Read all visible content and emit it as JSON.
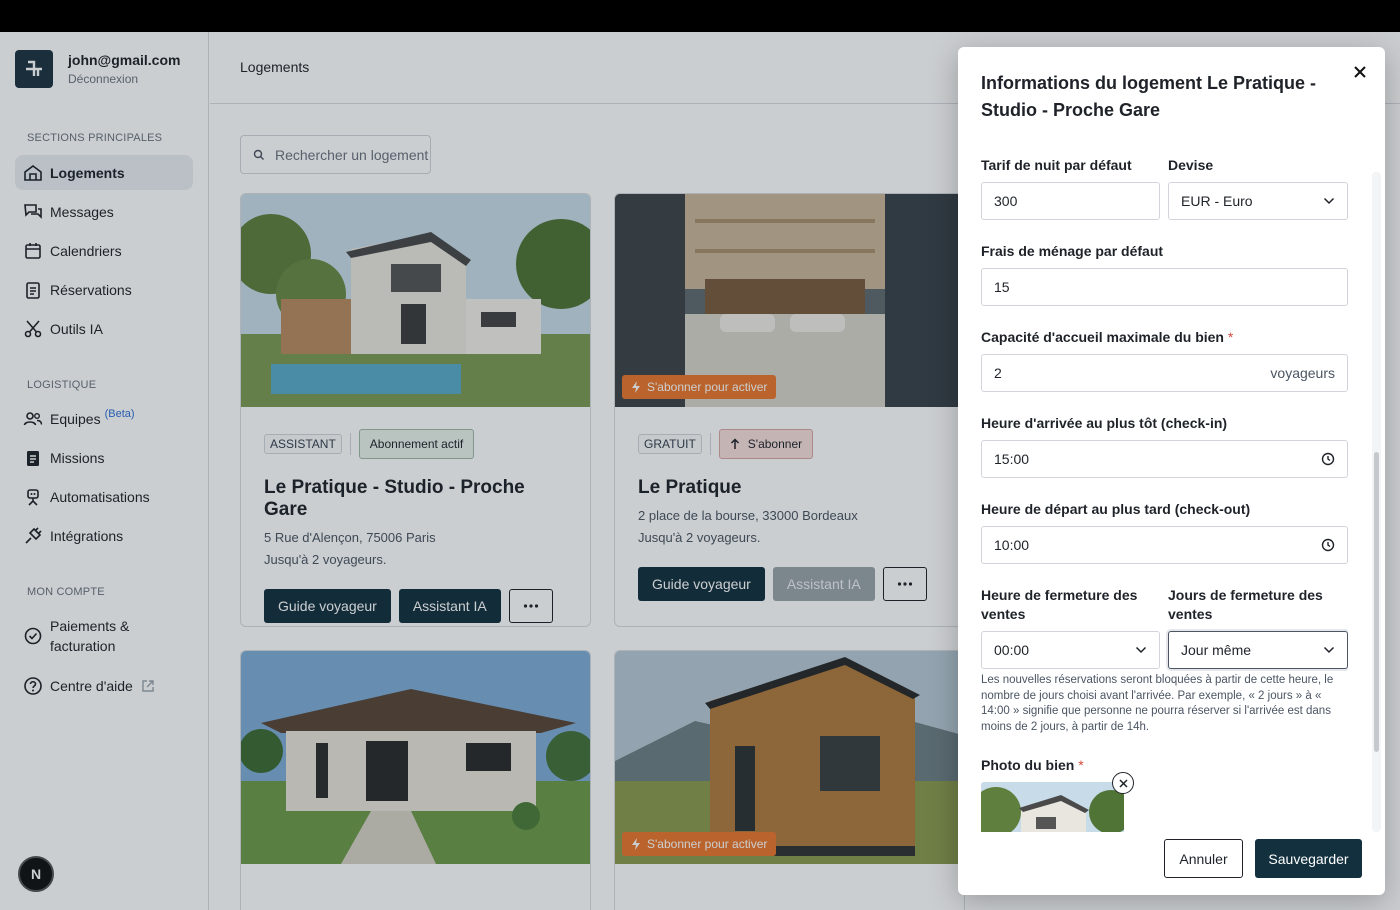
{
  "account": {
    "email": "john@gmail.com",
    "logout": "Déconnexion"
  },
  "sidebar": {
    "sections": [
      {
        "title": "SECTIONS PRINCIPALES"
      },
      {
        "title": "LOGISTIQUE"
      },
      {
        "title": "MON COMPTE"
      }
    ],
    "items": [
      {
        "label": "Logements",
        "icon": "home-icon"
      },
      {
        "label": "Messages",
        "icon": "chat-icon"
      },
      {
        "label": "Calendriers",
        "icon": "calendar-icon"
      },
      {
        "label": "Réservations",
        "icon": "clipboard-icon"
      },
      {
        "label": "Outils IA",
        "icon": "scissors-icon"
      },
      {
        "label": "Equipes",
        "badge": "(Beta)",
        "icon": "users-icon"
      },
      {
        "label": "Missions",
        "icon": "checklist-icon"
      },
      {
        "label": "Automatisations",
        "icon": "robot-icon"
      },
      {
        "label": "Intégrations",
        "icon": "plug-icon"
      },
      {
        "label": "Paiements & facturation",
        "icon": "check-badge-icon"
      },
      {
        "label": "Centre d'aide",
        "icon": "help-circle-icon"
      }
    ],
    "help_button": "N"
  },
  "main": {
    "title": "Logements",
    "search_placeholder": "Rechercher un logement",
    "cards": [
      {
        "tag": "ASSISTANT",
        "status": "Abonnement actif",
        "title": "Le Pratique - Studio - Proche Gare",
        "address": "5 Rue d'Alençon, 75006 Paris",
        "capacity": "Jusqu'à 2 voyageurs.",
        "guide": "Guide voyageur",
        "ai": "Assistant IA"
      },
      {
        "tag": "GRATUIT",
        "status": "S'abonner",
        "promo": "S'abonner pour activer",
        "title": "Le Pratique",
        "address": "2 place de la bourse, 33000 Bordeaux",
        "capacity": "Jusqu'à 2 voyageurs.",
        "guide": "Guide voyageur",
        "ai": "Assistant IA"
      },
      {
        "title": ""
      },
      {
        "promo": "S'abonner pour activer"
      }
    ]
  },
  "modal": {
    "title": "Informations du logement Le Pratique - Studio - Proche Gare",
    "fields": {
      "nightly_rate": {
        "label": "Tarif de nuit par défaut",
        "value": "300"
      },
      "currency": {
        "label": "Devise",
        "value": "EUR - Euro"
      },
      "cleaning_fee": {
        "label": "Frais de ménage par défaut",
        "value": "15"
      },
      "capacity": {
        "label": "Capacité d'accueil maximale du bien",
        "required": "*",
        "value": "2",
        "suffix": "voyageurs"
      },
      "checkin": {
        "label": "Heure d'arrivée au plus tôt (check-in)",
        "value": "15:00"
      },
      "checkout": {
        "label": "Heure de départ au plus tard (check-out)",
        "value": "10:00"
      },
      "sales_close_time": {
        "label": "Heure de fermeture des ventes",
        "value": "00:00"
      },
      "sales_close_days": {
        "label": "Jours de fermeture des ventes",
        "value": "Jour même"
      },
      "sales_help": "Les nouvelles réservations seront bloquées à partir de cette heure, le nombre de jours choisi avant l'arrivée. Par exemple, « 2 jours » à « 14:00 » signifie que personne ne pourra réserver si l'arrivée est dans moins de 2 jours, à partir de 14h.",
      "photo": {
        "label": "Photo du bien",
        "required": "*"
      }
    },
    "cancel": "Annuler",
    "save": "Sauvegarder"
  }
}
